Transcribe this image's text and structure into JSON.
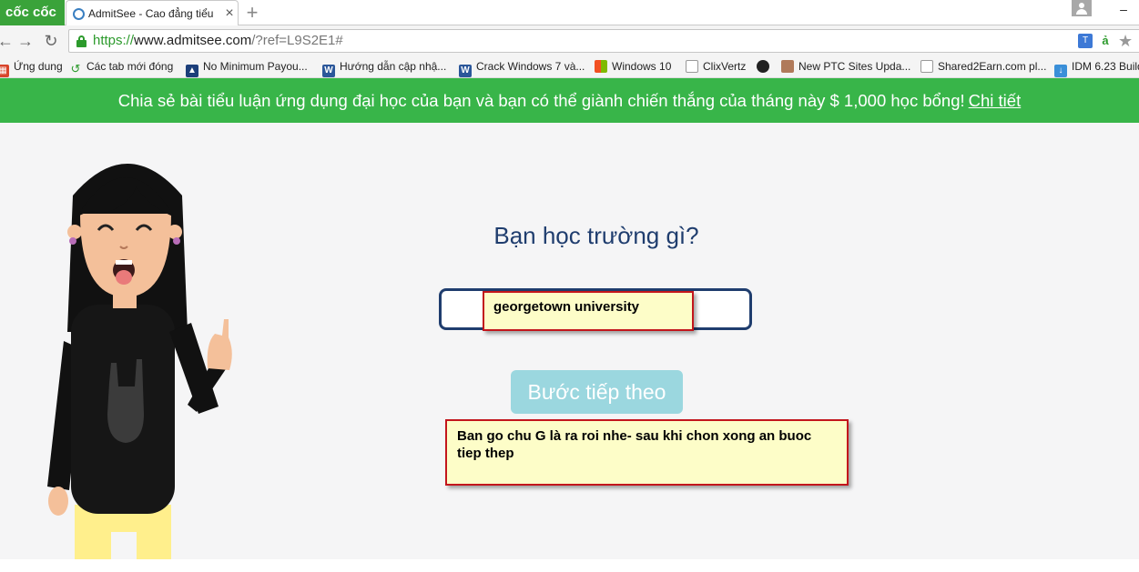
{
  "browser": {
    "brand": "cốc cốc",
    "tab_title": "AdmitSee - Cao đẳng tiểu",
    "tab_close": "×",
    "new_tab": "+",
    "minimize": "–",
    "back": "←",
    "forward": "→",
    "reload": "↻",
    "url": {
      "scheme": "https://",
      "host": "www.admitsee.com",
      "path": "/?ref=L9S2E1#"
    },
    "bookmarks": [
      {
        "label": "Ứng dung",
        "icon": "apps-icon",
        "color": "#d8442b"
      },
      {
        "label": "Các tab mới đóng",
        "icon": "history-icon",
        "color": "#2c9a2c"
      },
      {
        "label": "No Minimum Payou...",
        "icon": "mountain-icon",
        "color": "#1c3f7a"
      },
      {
        "label": "Hướng dẫn cập nhậ...",
        "icon": "word-icon",
        "color": "#2b579a"
      },
      {
        "label": "Crack Windows 7 và...",
        "icon": "word-icon",
        "color": "#2b579a"
      },
      {
        "label": "Windows 10",
        "icon": "windows-icon",
        "color": "#f25022"
      },
      {
        "label": "ClixVertz",
        "icon": "page-icon",
        "color": "#ffffff"
      },
      {
        "label": "",
        "icon": "circle-icon",
        "color": "#222222"
      },
      {
        "label": "New PTC Sites Upda...",
        "icon": "avatar-icon",
        "color": "#b07a5a"
      },
      {
        "label": "Shared2Earn.com pl...",
        "icon": "page-icon",
        "color": "#ffffff"
      },
      {
        "label": "IDM 6.23 Build",
        "icon": "idm-icon",
        "color": "#3a8fd8"
      }
    ]
  },
  "banner": {
    "text": "Chia sẻ bài tiểu luận ứng dụng đại học của bạn và bạn có thể giành chiến thắng của tháng này $ 1,000 học bổng!",
    "link": "Chi tiết",
    "color": "#38b549"
  },
  "main": {
    "question": "Bạn học trường gì?",
    "input_value": "",
    "next_button": "Bước tiếp theo"
  },
  "annotations": {
    "input_note": "georgetown university",
    "hint_note": "Ban go chu G là ra roi nhe- sau khi chon xong an buoc tiep thep"
  }
}
